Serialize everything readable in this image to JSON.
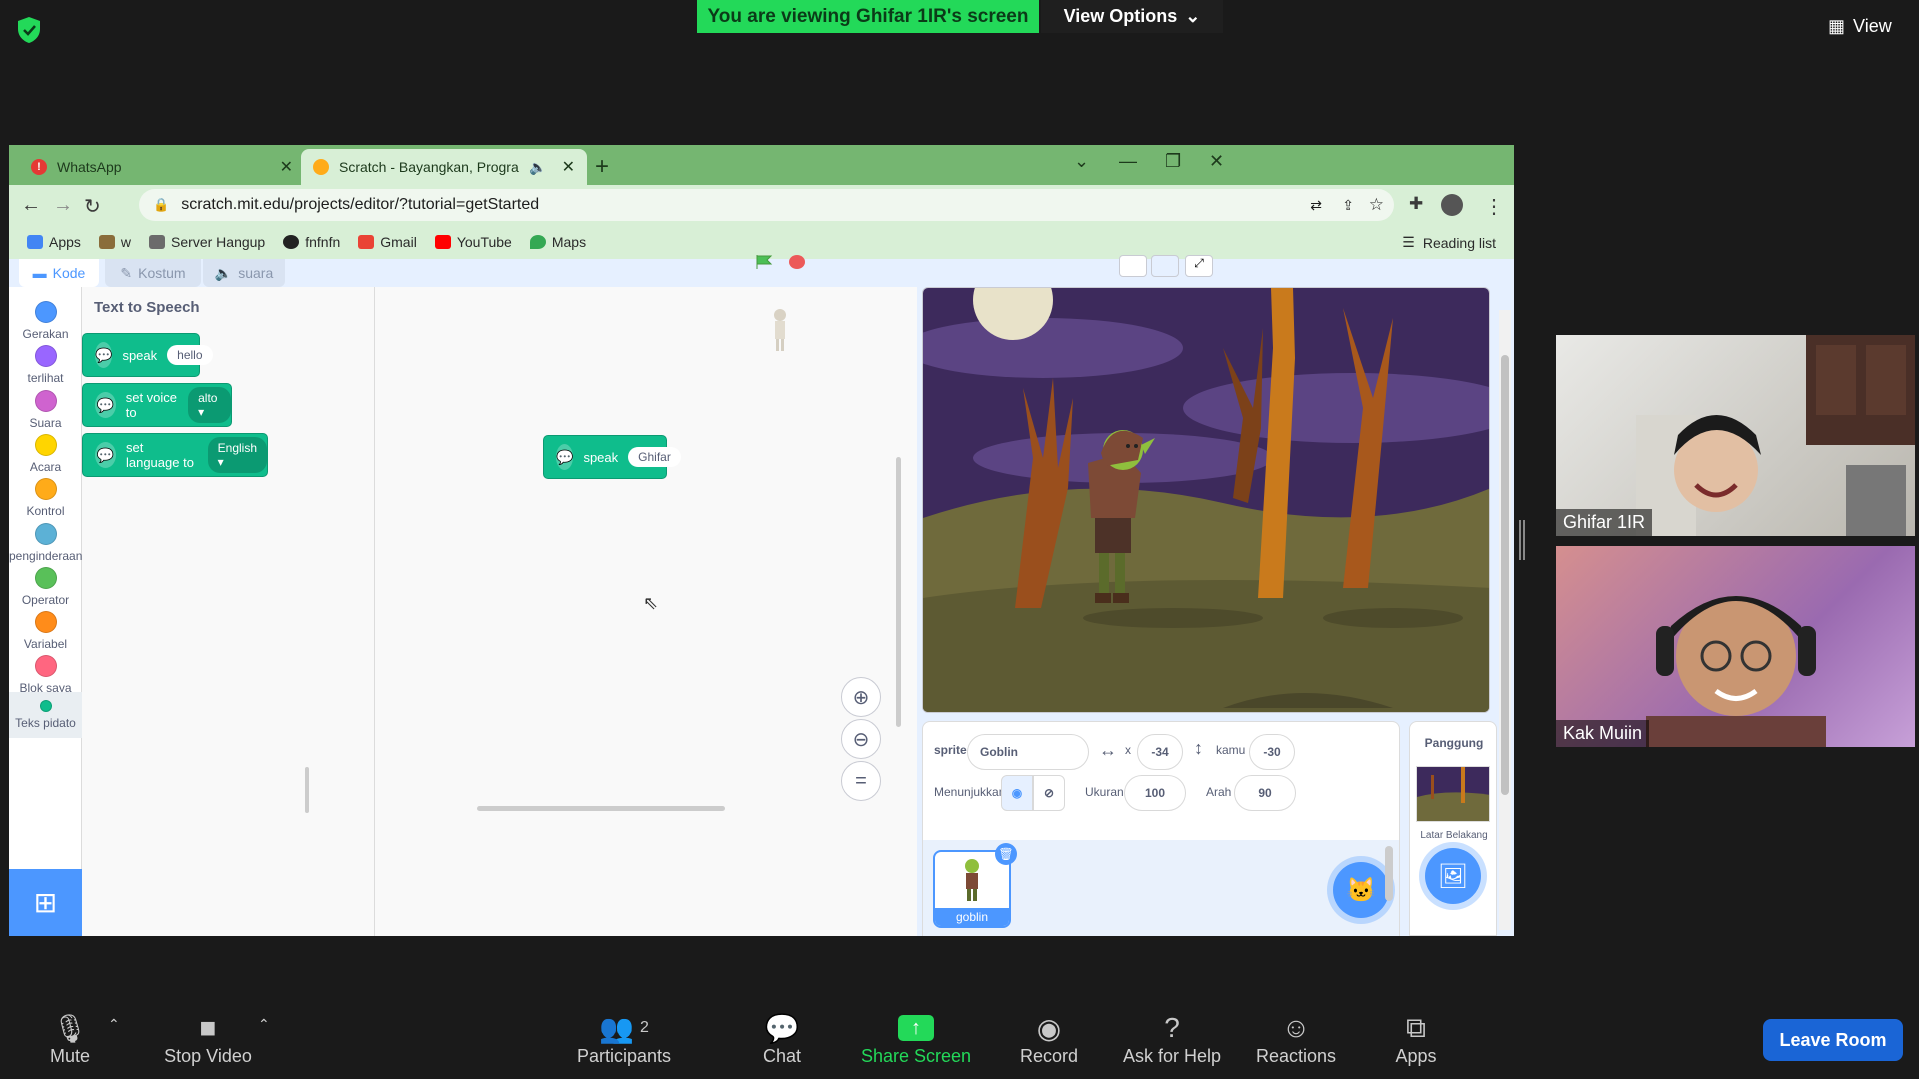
{
  "zoom": {
    "banner": "You are viewing Ghifar 1IR's screen",
    "view_options": "View Options",
    "view": "View",
    "participants": [
      {
        "name": "Ghifar 1IR"
      },
      {
        "name": "Kak Muiin"
      }
    ],
    "toolbar": {
      "mute": "Mute",
      "stop_video": "Stop Video",
      "participants": "Participants",
      "participants_count": "2",
      "chat": "Chat",
      "share_screen": "Share Screen",
      "record": "Record",
      "ask_for_help": "Ask for Help",
      "reactions": "Reactions",
      "apps": "Apps",
      "leave_room": "Leave Room"
    },
    "colors": {
      "share_green": "#23d959",
      "leave_blue": "#1a65d6"
    }
  },
  "browser": {
    "tabs": [
      {
        "title": "WhatsApp"
      },
      {
        "title": "Scratch - Bayangkan, Progran"
      }
    ],
    "url": "scratch.mit.edu/projects/editor/?tutorial=getStarted",
    "bookmarks": [
      {
        "label": "Apps",
        "color": "#4285f4"
      },
      {
        "label": "w",
        "color": "#8a6d3b"
      },
      {
        "label": "Server Hangup",
        "color": "#6b6b6b"
      },
      {
        "label": "fnfnfn",
        "color": "#222222"
      },
      {
        "label": "Gmail",
        "color": "#ea4335"
      },
      {
        "label": "YouTube",
        "color": "#ff0000"
      },
      {
        "label": "Maps",
        "color": "#34a853"
      }
    ],
    "reading_list": "Reading list"
  },
  "scratch": {
    "tabs": {
      "code": "Kode",
      "costumes": "Kostum",
      "sounds": "suara"
    },
    "categories": [
      {
        "label": "Gerakan",
        "color": "#4c97ff"
      },
      {
        "label": "terlihat",
        "color": "#9966ff"
      },
      {
        "label": "Suara",
        "color": "#cf63cf"
      },
      {
        "label": "Acara",
        "color": "#ffd500"
      },
      {
        "label": "Kontrol",
        "color": "#ffab19"
      },
      {
        "label": "penginderaan",
        "color": "#5cb1d6"
      },
      {
        "label": "Operator",
        "color": "#59c059"
      },
      {
        "label": "Variabel",
        "color": "#ff8c1a"
      },
      {
        "label": "Blok saya",
        "color": "#ff6680"
      },
      {
        "label": "Teks pidato",
        "color": "#0fbd8c"
      }
    ],
    "palette_title": "Text to Speech",
    "palette_blocks": [
      {
        "label": "speak",
        "arg": "hello",
        "type": "text"
      },
      {
        "label": "set voice to",
        "arg": "alto",
        "type": "dropdown"
      },
      {
        "label": "set language to",
        "arg": "English",
        "type": "dropdown"
      }
    ],
    "code_block": {
      "label": "speak",
      "arg": "Ghifar"
    },
    "sprite_info": {
      "sprite_label": "sprite",
      "sprite_name": "Goblin",
      "x_label": "x",
      "x_value": "-34",
      "y_label": "kamu",
      "y_value": "-30",
      "show_label": "Menunjukkan",
      "size_label": "Ukuran",
      "size_value": "100",
      "direction_label": "Arah",
      "direction_value": "90"
    },
    "sprite_thumb_label": "goblin",
    "stage_pane": {
      "title": "Panggung",
      "backdrops_label": "Latar Belakang"
    }
  }
}
